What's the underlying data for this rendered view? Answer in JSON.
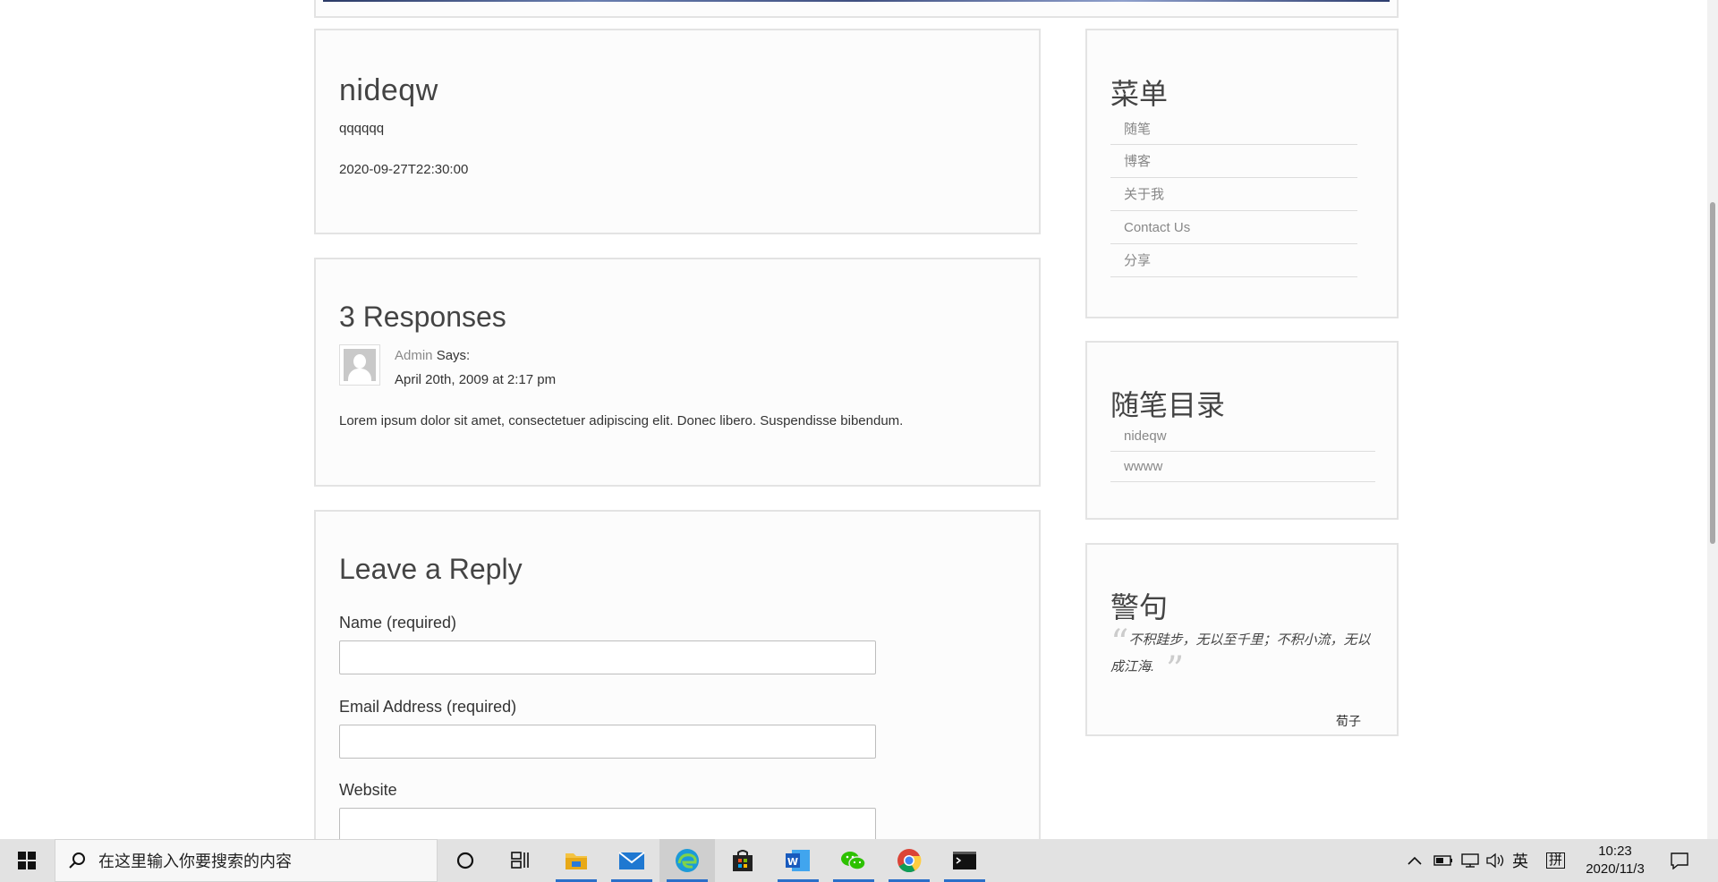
{
  "post": {
    "title": "nideqw",
    "body": "qqqqqq",
    "date": "2020-09-27T22:30:00"
  },
  "responses": {
    "title": "3 Responses",
    "comment": {
      "author": "Admin",
      "says": "Says:",
      "date": "April 20th, 2009 at 2:17 pm",
      "text": "Lorem ipsum dolor sit amet, consectetuer adipiscing elit. Donec libero. Suspendisse bibendum."
    }
  },
  "reply": {
    "title": "Leave a Reply",
    "name_label": "Name (required)",
    "email_label": "Email Address (required)",
    "website_label": "Website",
    "name_value": "",
    "email_value": "",
    "website_value": ""
  },
  "sidebar": {
    "menu_title": "菜单",
    "menu_items": [
      "随笔",
      "博客",
      "关于我",
      "Contact Us",
      "分享"
    ],
    "catalog_title": "随笔目录",
    "catalog_items": [
      "nideqw",
      "wwww"
    ],
    "quote_title": "警句",
    "quote_text": "不积跬步，无以至千里；不积小流，无以成江海.",
    "quote_author": "荀子"
  },
  "taskbar": {
    "search_placeholder": "在这里输入你要搜索的内容",
    "apps": [
      "cortana-icon",
      "task-view-icon",
      "file-explorer-icon",
      "mail-icon",
      "edge-icon",
      "store-icon",
      "word-icon",
      "wechat-icon",
      "chrome-icon",
      "terminal-icon"
    ],
    "ime_lang": "英",
    "ime_mode": "拼",
    "time": "10:23",
    "date": "2020/11/3"
  },
  "colors": {
    "accent": "#2a6fc9",
    "panel_border": "#e3e3e3",
    "link_gray": "#888888"
  }
}
